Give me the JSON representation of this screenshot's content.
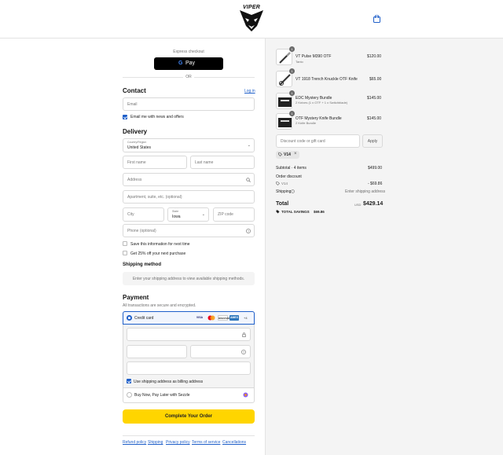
{
  "header": {
    "logo_text": "VIPER"
  },
  "express": {
    "label": "Express checkout",
    "gpay_label": "Pay",
    "or_label": "OR"
  },
  "contact": {
    "title": "Contact",
    "login_label": "Log in",
    "email_placeholder": "Email",
    "news_label": "Email me with news and offers"
  },
  "delivery": {
    "title": "Delivery",
    "country_label": "Country/Region",
    "country_value": "United States",
    "first_name": "First name",
    "last_name": "Last name",
    "address": "Address",
    "apartment": "Apartment, suite, etc. (optional)",
    "city": "City",
    "state_label": "State",
    "state_value": "Iowa",
    "zip": "ZIP code",
    "phone": "Phone (optional)",
    "save_info": "Save this information for next time",
    "get_discount": "Get 25% off your next purchase"
  },
  "shipping_method": {
    "title": "Shipping method",
    "message": "Enter your shipping address to view available shipping methods."
  },
  "payment": {
    "title": "Payment",
    "subtitle": "All transactions are secure and encrypted.",
    "credit_card_label": "Credit card",
    "card_brands": [
      "VISA",
      "MC",
      "DISCOVER",
      "AMEX"
    ],
    "more_brands": "+4",
    "billing_label": "Use shipping address as billing address",
    "sezzle_label": "Buy Now, Pay Later with Sezzle"
  },
  "complete_button": "Complete Your Order",
  "footer_links": [
    "Refund policy",
    "Shipping",
    "Privacy policy",
    "Terms of service",
    "Cancellations"
  ],
  "cart": {
    "items": [
      {
        "name": "VT Pulse M390 OTF",
        "variant": "Tanto",
        "price": "$120.00",
        "qty": "1"
      },
      {
        "name": "VT 1918 Trench Knuckle OTF Knife",
        "variant": "",
        "price": "$65.00",
        "qty": "1"
      },
      {
        "name": "EDC Mystery Bundle",
        "variant": "2 Knives (1 x OTF + 1 x Switchblade)",
        "price": "$145.00",
        "qty": "1"
      },
      {
        "name": "OTF Mystery Knife Bundle",
        "variant": "2 Knife Bundle",
        "price": "$145.00",
        "qty": "1"
      }
    ],
    "discount_placeholder": "Discount code or gift card",
    "apply_label": "Apply",
    "code_tag": "V14",
    "subtotal_label": "Subtotal · 4 items",
    "subtotal_value": "$499.00",
    "order_discount_label": "Order discount",
    "discount_code": "V14",
    "discount_value": "- $69.86",
    "shipping_label": "Shipping",
    "shipping_value": "Enter shipping address",
    "total_label": "Total",
    "currency": "USD",
    "total_value": "$429.14",
    "savings_label": "TOTAL SAVINGS",
    "savings_value": "$69.86"
  },
  "colors": {
    "accent": "#1f5fc9",
    "cta": "#ffd500",
    "panel": "#f4f4f4"
  }
}
